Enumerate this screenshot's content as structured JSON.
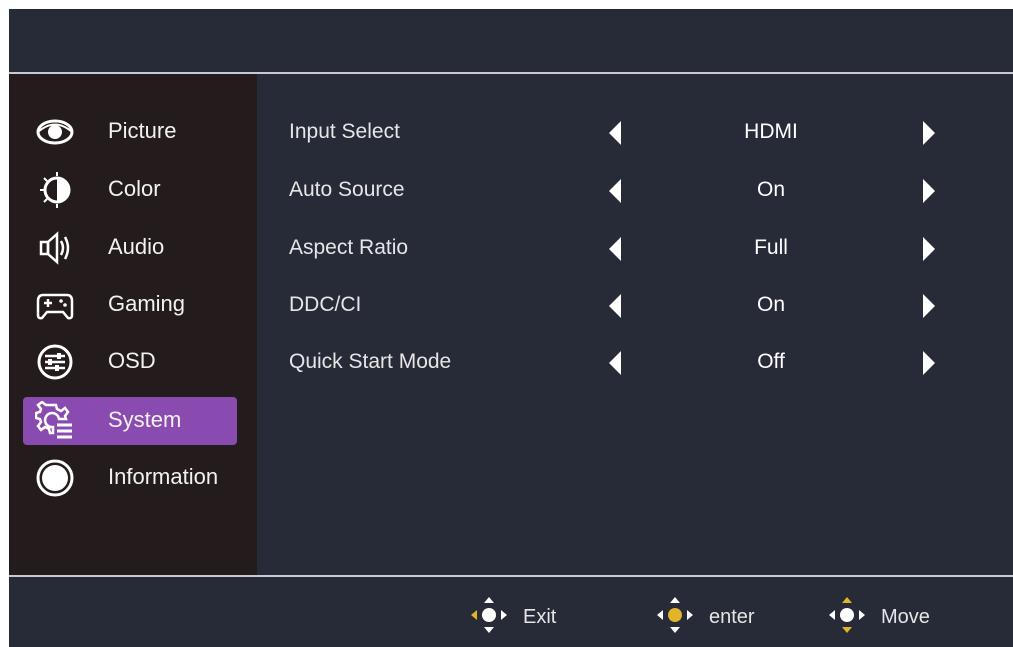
{
  "colors": {
    "background": "#272a37",
    "sidebar": "#231b1c",
    "active": "#8a4bb0",
    "accent": "#e0b52a",
    "text": "#ffffff"
  },
  "sidebar": {
    "items": [
      {
        "label": "Picture",
        "icon": "eye-icon"
      },
      {
        "label": "Color",
        "icon": "color-icon"
      },
      {
        "label": "Audio",
        "icon": "speaker-icon"
      },
      {
        "label": "Gaming",
        "icon": "gamepad-icon"
      },
      {
        "label": "OSD",
        "icon": "sliders-icon"
      },
      {
        "label": "System",
        "icon": "system-gear-icon",
        "active": true
      },
      {
        "label": "Information",
        "icon": "info-circle-icon"
      }
    ]
  },
  "settings": [
    {
      "label": "Input Select",
      "value": "HDMI"
    },
    {
      "label": "Auto Source",
      "value": "On"
    },
    {
      "label": "Aspect Ratio",
      "value": "Full"
    },
    {
      "label": "DDC/CI",
      "value": "On"
    },
    {
      "label": "Quick Start Mode",
      "value": "Off"
    }
  ],
  "footer": {
    "exit_label": "Exit",
    "enter_label": "enter",
    "move_label": "Move"
  }
}
